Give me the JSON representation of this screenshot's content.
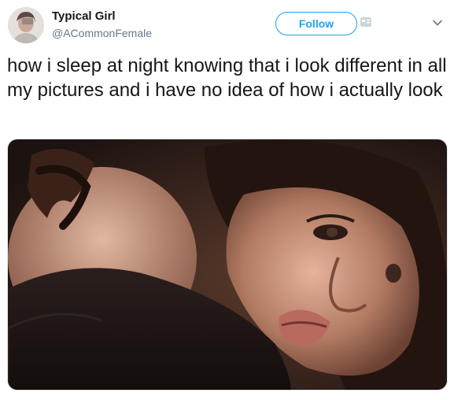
{
  "user": {
    "display_name": "Typical Girl",
    "handle": "@ACommonFemale"
  },
  "actions": {
    "follow_label": "Follow"
  },
  "tweet": {
    "text": "how i sleep at night knowing that i look different in all my pictures and i have no idea of how i actually look"
  },
  "icons": {
    "follow_icon": "follow-badge-icon",
    "menu_icon": "chevron-down-icon"
  },
  "colors": {
    "accent": "#1da1f2",
    "text": "#14171a",
    "muted": "#657786"
  }
}
